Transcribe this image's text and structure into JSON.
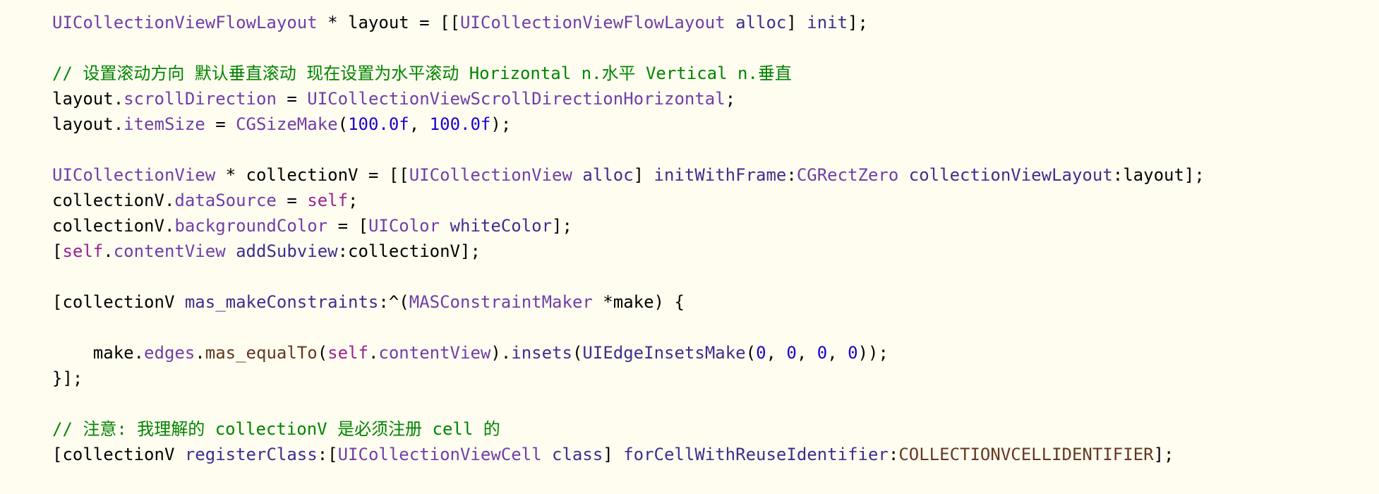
{
  "colors": {
    "background": "#fffdf0",
    "plain": "#000000",
    "class": "#703daa",
    "method": "#3f2d8f",
    "property": "#703daa",
    "keyword": "#9b2393",
    "number": "#1c00cf",
    "comment": "#008400",
    "macro": "#643820",
    "function": "#3f2d8f"
  },
  "lines": [
    [
      {
        "t": "UICollectionViewFlowLayout",
        "c": "class"
      },
      {
        "t": " * layout = [[",
        "c": "plain"
      },
      {
        "t": "UICollectionViewFlowLayout",
        "c": "class"
      },
      {
        "t": " ",
        "c": "plain"
      },
      {
        "t": "alloc",
        "c": "method"
      },
      {
        "t": "] ",
        "c": "plain"
      },
      {
        "t": "init",
        "c": "method"
      },
      {
        "t": "];",
        "c": "plain"
      }
    ],
    [],
    [
      {
        "t": "// 设置滚动方向 默认垂直滚动 现在设置为水平滚动 Horizontal n.水平 Vertical n.垂直",
        "c": "comment"
      }
    ],
    [
      {
        "t": "layout.",
        "c": "plain"
      },
      {
        "t": "scrollDirection",
        "c": "property"
      },
      {
        "t": " = ",
        "c": "plain"
      },
      {
        "t": "UICollectionViewScrollDirectionHorizontal",
        "c": "class"
      },
      {
        "t": ";",
        "c": "plain"
      }
    ],
    [
      {
        "t": "layout.",
        "c": "plain"
      },
      {
        "t": "itemSize",
        "c": "property"
      },
      {
        "t": " = ",
        "c": "plain"
      },
      {
        "t": "CGSizeMake",
        "c": "class"
      },
      {
        "t": "(",
        "c": "plain"
      },
      {
        "t": "100.0f",
        "c": "number"
      },
      {
        "t": ", ",
        "c": "plain"
      },
      {
        "t": "100.0f",
        "c": "number"
      },
      {
        "t": ");",
        "c": "plain"
      }
    ],
    [],
    [
      {
        "t": "UICollectionView",
        "c": "class"
      },
      {
        "t": " * collectionV = [[",
        "c": "plain"
      },
      {
        "t": "UICollectionView",
        "c": "class"
      },
      {
        "t": " ",
        "c": "plain"
      },
      {
        "t": "alloc",
        "c": "method"
      },
      {
        "t": "] ",
        "c": "plain"
      },
      {
        "t": "initWithFrame",
        "c": "method"
      },
      {
        "t": ":",
        "c": "plain"
      },
      {
        "t": "CGRectZero",
        "c": "class"
      },
      {
        "t": " ",
        "c": "plain"
      },
      {
        "t": "collectionViewLayout",
        "c": "method"
      },
      {
        "t": ":layout];",
        "c": "plain"
      }
    ],
    [
      {
        "t": "collectionV.",
        "c": "plain"
      },
      {
        "t": "dataSource",
        "c": "property"
      },
      {
        "t": " = ",
        "c": "plain"
      },
      {
        "t": "self",
        "c": "keyword"
      },
      {
        "t": ";",
        "c": "plain"
      }
    ],
    [
      {
        "t": "collectionV.",
        "c": "plain"
      },
      {
        "t": "backgroundColor",
        "c": "property"
      },
      {
        "t": " = [",
        "c": "plain"
      },
      {
        "t": "UIColor",
        "c": "class"
      },
      {
        "t": " ",
        "c": "plain"
      },
      {
        "t": "whiteColor",
        "c": "method"
      },
      {
        "t": "];",
        "c": "plain"
      }
    ],
    [
      {
        "t": "[",
        "c": "plain"
      },
      {
        "t": "self",
        "c": "keyword"
      },
      {
        "t": ".",
        "c": "plain"
      },
      {
        "t": "contentView",
        "c": "property"
      },
      {
        "t": " ",
        "c": "plain"
      },
      {
        "t": "addSubview",
        "c": "method"
      },
      {
        "t": ":collectionV];",
        "c": "plain"
      }
    ],
    [],
    [
      {
        "t": "[collectionV ",
        "c": "plain"
      },
      {
        "t": "mas_makeConstraints",
        "c": "method"
      },
      {
        "t": ":^(",
        "c": "plain"
      },
      {
        "t": "MASConstraintMaker",
        "c": "class"
      },
      {
        "t": " *make) {",
        "c": "plain"
      }
    ],
    [],
    [
      {
        "t": "    make.",
        "c": "plain"
      },
      {
        "t": "edges",
        "c": "property"
      },
      {
        "t": ".",
        "c": "plain"
      },
      {
        "t": "mas_equalTo",
        "c": "macro"
      },
      {
        "t": "(",
        "c": "plain"
      },
      {
        "t": "self",
        "c": "keyword"
      },
      {
        "t": ".",
        "c": "plain"
      },
      {
        "t": "contentView",
        "c": "property"
      },
      {
        "t": ").",
        "c": "plain"
      },
      {
        "t": "insets",
        "c": "method"
      },
      {
        "t": "(",
        "c": "plain"
      },
      {
        "t": "UIEdgeInsetsMake",
        "c": "function"
      },
      {
        "t": "(",
        "c": "plain"
      },
      {
        "t": "0",
        "c": "number"
      },
      {
        "t": ", ",
        "c": "plain"
      },
      {
        "t": "0",
        "c": "number"
      },
      {
        "t": ", ",
        "c": "plain"
      },
      {
        "t": "0",
        "c": "number"
      },
      {
        "t": ", ",
        "c": "plain"
      },
      {
        "t": "0",
        "c": "number"
      },
      {
        "t": "));",
        "c": "plain"
      }
    ],
    [
      {
        "t": "}];",
        "c": "plain"
      }
    ],
    [],
    [
      {
        "t": "// 注意: 我理解的 collectionV 是必须注册 cell 的",
        "c": "comment"
      }
    ],
    [
      {
        "t": "[collectionV ",
        "c": "plain"
      },
      {
        "t": "registerClass",
        "c": "method"
      },
      {
        "t": ":[",
        "c": "plain"
      },
      {
        "t": "UICollectionViewCell",
        "c": "class"
      },
      {
        "t": " ",
        "c": "plain"
      },
      {
        "t": "class",
        "c": "method"
      },
      {
        "t": "] ",
        "c": "plain"
      },
      {
        "t": "forCellWithReuseIdentifier",
        "c": "method"
      },
      {
        "t": ":",
        "c": "plain"
      },
      {
        "t": "COLLECTIONVCELLIDENTIFIER",
        "c": "macro"
      },
      {
        "t": "];",
        "c": "plain"
      }
    ]
  ]
}
